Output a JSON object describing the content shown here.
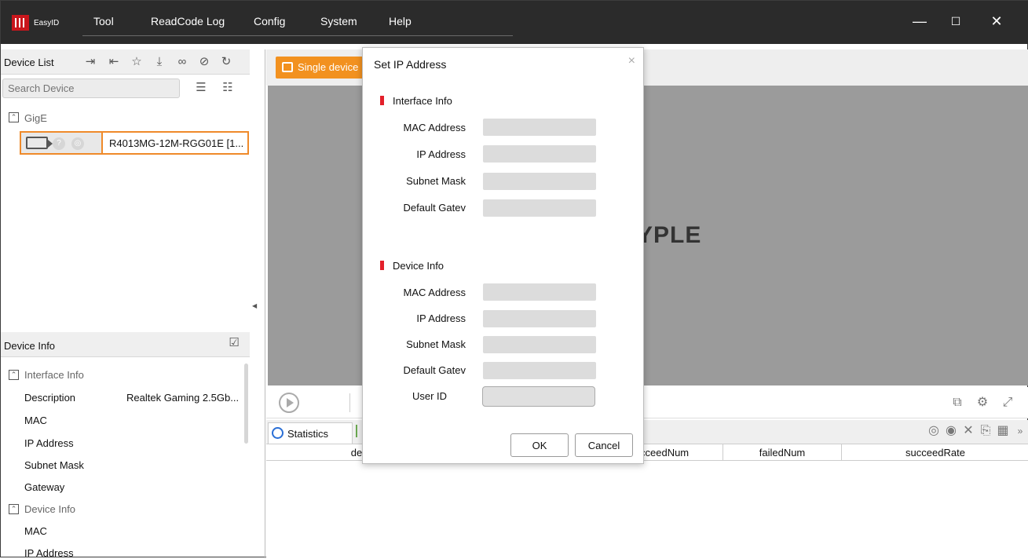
{
  "app": {
    "logo_text": "EasyID"
  },
  "menu": {
    "items": [
      "Tool",
      "ReadCode Log",
      "Config",
      "System",
      "Help"
    ]
  },
  "window_controls": {
    "minimize": "—",
    "maximize": "☐",
    "close": "✕"
  },
  "device_list": {
    "title": "Device List",
    "search_placeholder": "Search Device",
    "group": "GigE",
    "device_name": "R4013MG-12M-RGG01E [1..."
  },
  "device_info": {
    "title": "Device Info",
    "interface_section": "Interface Info",
    "interface_rows": [
      {
        "label": "Description",
        "value": "Realtek Gaming 2.5Gb..."
      },
      {
        "label": "MAC",
        "value": ""
      },
      {
        "label": "IP Address",
        "value": ""
      },
      {
        "label": "Subnet Mask",
        "value": ""
      },
      {
        "label": "Gateway",
        "value": ""
      }
    ],
    "device_section": "Device Info",
    "device_rows": [
      {
        "label": "MAC",
        "value": ""
      },
      {
        "label": "IP Address",
        "value": ""
      }
    ]
  },
  "viewer": {
    "tab_label": "Single device",
    "watermark": "YPLE"
  },
  "stats": {
    "tab_label": "Statistics",
    "columns": [
      "de",
      "cceedNum",
      "failedNum",
      "succeedRate"
    ]
  },
  "dialog": {
    "title": "Set IP Address",
    "close": "×",
    "interface_section": "Interface Info",
    "interface_fields": [
      {
        "label": "MAC Address",
        "value": ""
      },
      {
        "label": "IP Address",
        "value": ""
      },
      {
        "label": "Subnet Mask",
        "value": ""
      },
      {
        "label": "Default Gatev",
        "value": ""
      }
    ],
    "device_section": "Device Info",
    "device_fields": [
      {
        "label": "MAC Address",
        "value": ""
      },
      {
        "label": "IP Address",
        "value": ""
      },
      {
        "label": "Subnet Mask",
        "value": ""
      },
      {
        "label": "Default Gatev",
        "value": ""
      },
      {
        "label": "User ID",
        "value": ""
      }
    ],
    "ok_label": "OK",
    "cancel_label": "Cancel"
  },
  "colors": {
    "accent": "#f2911f",
    "section_marker": "#e3202a",
    "titlebar": "#2b2b2b"
  }
}
